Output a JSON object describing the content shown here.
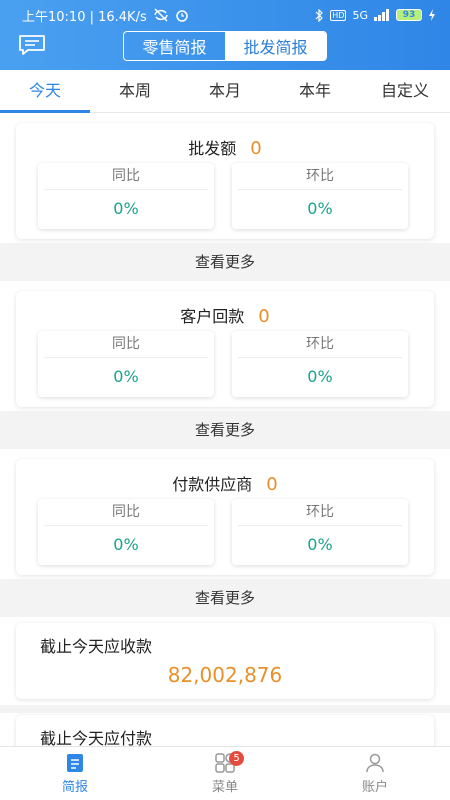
{
  "status_bar": {
    "time_network": "上午10:10 | 16.4K/s",
    "signal": "5G",
    "battery": "93"
  },
  "header": {
    "segments": [
      {
        "label": "零售简报",
        "active": false
      },
      {
        "label": "批发简报",
        "active": true
      }
    ]
  },
  "tabs": [
    "今天",
    "本周",
    "本月",
    "本年",
    "自定义"
  ],
  "cards": [
    {
      "title": "批发额",
      "value": "0",
      "yoy_label": "同比",
      "yoy_value": "0%",
      "mom_label": "环比",
      "mom_value": "0%",
      "more": "查看更多"
    },
    {
      "title": "客户回款",
      "value": "0",
      "yoy_label": "同比",
      "yoy_value": "0%",
      "mom_label": "环比",
      "mom_value": "0%",
      "more": "查看更多"
    },
    {
      "title": "付款供应商",
      "value": "0",
      "yoy_label": "同比",
      "yoy_value": "0%",
      "mom_label": "环比",
      "mom_value": "0%",
      "more": "查看更多"
    }
  ],
  "receivable": {
    "title": "截止今天应收款",
    "value": "82,002,876"
  },
  "payable": {
    "title": "截止今天应付款"
  },
  "bottom_nav": {
    "items": [
      {
        "label": "简报",
        "icon": "document-icon",
        "active": true
      },
      {
        "label": "菜单",
        "icon": "grid-icon",
        "badge": "5"
      },
      {
        "label": "账户",
        "icon": "user-icon"
      }
    ]
  },
  "colors": {
    "primary": "#2f86e6",
    "accent": "#e8902a",
    "positive": "#1aa38a",
    "badge": "#e54b3c"
  }
}
